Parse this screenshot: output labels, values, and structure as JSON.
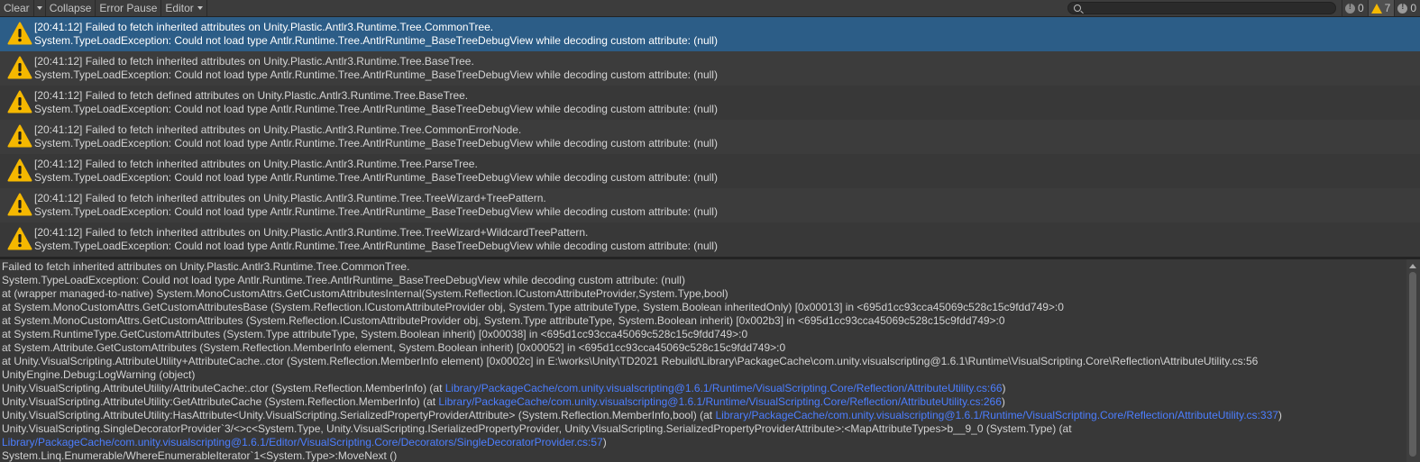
{
  "toolbar": {
    "clear_label": "Clear",
    "collapse_label": "Collapse",
    "error_pause_label": "Error Pause",
    "editor_label": "Editor",
    "search_value": "",
    "info_count": "0",
    "warning_count": "7",
    "error_count": "0"
  },
  "colors": {
    "selection": "#2c5d87",
    "warning": "#f5b800",
    "link": "#4c7eff"
  },
  "log_entries": [
    {
      "line1": "[20:41:12] Failed to fetch inherited attributes on Unity.Plastic.Antlr3.Runtime.Tree.CommonTree.",
      "line2": "System.TypeLoadException: Could not load type Antlr.Runtime.Tree.AntlrRuntime_BaseTreeDebugView while decoding custom attribute: (null)",
      "icon": "warning-icon"
    },
    {
      "line1": "[20:41:12] Failed to fetch inherited attributes on Unity.Plastic.Antlr3.Runtime.Tree.BaseTree.",
      "line2": "System.TypeLoadException: Could not load type Antlr.Runtime.Tree.AntlrRuntime_BaseTreeDebugView while decoding custom attribute: (null)",
      "icon": "warning-icon"
    },
    {
      "line1": "[20:41:12] Failed to fetch defined attributes on Unity.Plastic.Antlr3.Runtime.Tree.BaseTree.",
      "line2": "System.TypeLoadException: Could not load type Antlr.Runtime.Tree.AntlrRuntime_BaseTreeDebugView while decoding custom attribute: (null)",
      "icon": "warning-icon"
    },
    {
      "line1": "[20:41:12] Failed to fetch inherited attributes on Unity.Plastic.Antlr3.Runtime.Tree.CommonErrorNode.",
      "line2": "System.TypeLoadException: Could not load type Antlr.Runtime.Tree.AntlrRuntime_BaseTreeDebugView while decoding custom attribute: (null)",
      "icon": "warning-icon"
    },
    {
      "line1": "[20:41:12] Failed to fetch inherited attributes on Unity.Plastic.Antlr3.Runtime.Tree.ParseTree.",
      "line2": "System.TypeLoadException: Could not load type Antlr.Runtime.Tree.AntlrRuntime_BaseTreeDebugView while decoding custom attribute: (null)",
      "icon": "warning-icon"
    },
    {
      "line1": "[20:41:12] Failed to fetch inherited attributes on Unity.Plastic.Antlr3.Runtime.Tree.TreeWizard+TreePattern.",
      "line2": "System.TypeLoadException: Could not load type Antlr.Runtime.Tree.AntlrRuntime_BaseTreeDebugView while decoding custom attribute: (null)",
      "icon": "warning-icon"
    },
    {
      "line1": "[20:41:12] Failed to fetch inherited attributes on Unity.Plastic.Antlr3.Runtime.Tree.TreeWizard+WildcardTreePattern.",
      "line2": "System.TypeLoadException: Could not load type Antlr.Runtime.Tree.AntlrRuntime_BaseTreeDebugView while decoding custom attribute: (null)",
      "icon": "warning-icon"
    }
  ],
  "detail": {
    "lines": [
      {
        "text": "Failed to fetch inherited attributes on Unity.Plastic.Antlr3.Runtime.Tree.CommonTree."
      },
      {
        "text": "System.TypeLoadException: Could not load type Antlr.Runtime.Tree.AntlrRuntime_BaseTreeDebugView while decoding custom attribute: (null)"
      },
      {
        "text": "  at (wrapper managed-to-native) System.MonoCustomAttrs.GetCustomAttributesInternal(System.Reflection.ICustomAttributeProvider,System.Type,bool)"
      },
      {
        "text": "  at System.MonoCustomAttrs.GetCustomAttributesBase (System.Reflection.ICustomAttributeProvider obj, System.Type attributeType, System.Boolean inheritedOnly) [0x00013] in <695d1cc93cca45069c528c15c9fdd749>:0"
      },
      {
        "text": "  at System.MonoCustomAttrs.GetCustomAttributes (System.Reflection.ICustomAttributeProvider obj, System.Type attributeType, System.Boolean inherit) [0x002b3] in <695d1cc93cca45069c528c15c9fdd749>:0"
      },
      {
        "text": "  at System.RuntimeType.GetCustomAttributes (System.Type attributeType, System.Boolean inherit) [0x00038] in <695d1cc93cca45069c528c15c9fdd749>:0"
      },
      {
        "text": "  at System.Attribute.GetCustomAttributes (System.Reflection.MemberInfo element, System.Boolean inherit) [0x00052] in <695d1cc93cca45069c528c15c9fdd749>:0"
      },
      {
        "text": "  at Unity.VisualScripting.AttributeUtility+AttributeCache..ctor (System.Reflection.MemberInfo element) [0x0002c] in E:\\works\\Unity\\TD2021 Rebuild\\Library\\PackageCache\\com.unity.visualscripting@1.6.1\\Runtime\\VisualScripting.Core\\Reflection\\AttributeUtility.cs:56"
      },
      {
        "text": "UnityEngine.Debug:LogWarning (object)"
      },
      {
        "text": "Unity.VisualScripting.AttributeUtility/AttributeCache:.ctor (System.Reflection.MemberInfo) (at ",
        "link": "Library/PackageCache/com.unity.visualscripting@1.6.1/Runtime/VisualScripting.Core/Reflection/AttributeUtility.cs:66",
        "after": ")"
      },
      {
        "text": "Unity.VisualScripting.AttributeUtility:GetAttributeCache (System.Reflection.MemberInfo) (at ",
        "link": "Library/PackageCache/com.unity.visualscripting@1.6.1/Runtime/VisualScripting.Core/Reflection/AttributeUtility.cs:266",
        "after": ")"
      },
      {
        "text": "Unity.VisualScripting.AttributeUtility:HasAttribute<Unity.VisualScripting.SerializedPropertyProviderAttribute> (System.Reflection.MemberInfo,bool) (at ",
        "link": "Library/PackageCache/com.unity.visualscripting@1.6.1/Runtime/VisualScripting.Core/Reflection/AttributeUtility.cs:337",
        "after": ")"
      },
      {
        "text": "Unity.VisualScripting.SingleDecoratorProvider`3/<>c<System.Type, Unity.VisualScripting.ISerializedPropertyProvider, Unity.VisualScripting.SerializedPropertyProviderAttribute>:<MapAttributeTypes>b__9_0 (System.Type) (at"
      },
      {
        "text": "",
        "link": "Library/PackageCache/com.unity.visualscripting@1.6.1/Editor/VisualScripting.Core/Decorators/SingleDecoratorProvider.cs:57",
        "after": ")"
      },
      {
        "text": "System.Linq.Enumerable/WhereEnumerableIterator`1<System.Type>:MoveNext ()"
      }
    ]
  }
}
